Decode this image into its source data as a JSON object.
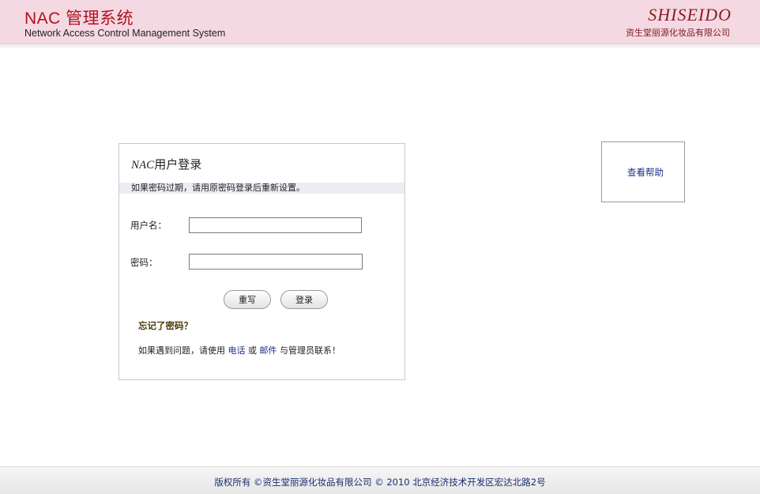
{
  "header": {
    "title": "NAC 管理系统",
    "subtitle": "Network Access Control Management System",
    "brand_logo": "SHISEIDO",
    "brand_name": "资生堂丽源化妆品有限公司",
    "colors": {
      "background": "#f5d9e2",
      "title": "#b0121f"
    }
  },
  "login": {
    "title_prefix": "NAC",
    "title_suffix": "用户登录",
    "notice": "如果密码过期，请用原密码登录后重新设置。",
    "username_label": "用户名：",
    "username_value": "",
    "password_label": "密码：",
    "password_value": "",
    "reset_button": "重写",
    "login_button": "登录",
    "forgot_password": "忘记了密码？",
    "help_prefix": "如果遇到问题，请使用 ",
    "help_phone": "电话",
    "help_or": " 或 ",
    "help_email": "邮件",
    "help_suffix": " 与管理员联系！"
  },
  "help_box": {
    "link": "查看帮助"
  },
  "footer": {
    "text": "版权所有 ©资生堂丽源化妆品有限公司 © 2010 北京经济技术开发区宏达北路2号"
  }
}
